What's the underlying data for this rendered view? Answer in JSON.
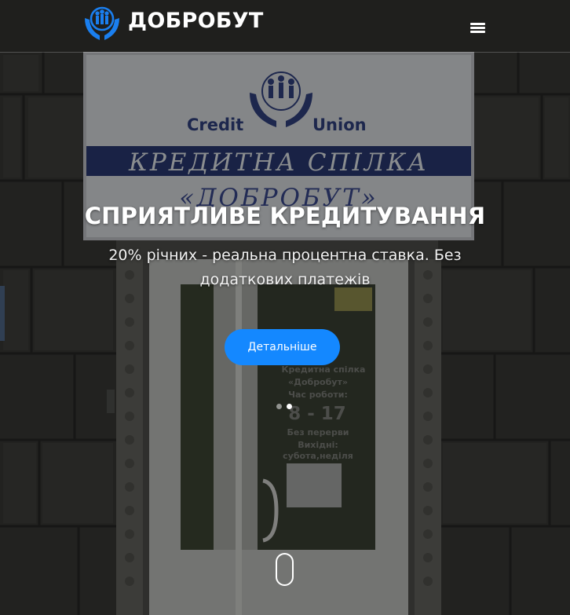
{
  "header": {
    "brand_name": "ДОБРОБУТ",
    "logo_icon": "hands-family-icon",
    "menu_icon": "hamburger-menu-icon"
  },
  "background": {
    "description_icon": "office-entrance-photo",
    "sign_top": "Credit Union",
    "sign_middle": "КРЕДИТНА СПІЛКА",
    "sign_bottom": "«ДОБРОБУТ»",
    "door_notice": {
      "line1": "Кредитна спілка",
      "line2": "«Добробут»",
      "line3": "Час роботи:",
      "line4": "8 - 17",
      "line5": "Без перерви",
      "line6": "Вихідні:",
      "line7": "субота,неділя"
    }
  },
  "slide": {
    "title": "СПРИЯТЛИВЕ КРЕДИТУВАННЯ",
    "subtitle": "20% річних - реальна процентна ставка. Без додаткових платежів",
    "button_label": "Детальніше"
  },
  "carousel": {
    "slides_count": 2,
    "active_index": 1
  },
  "scroll_indicator": "scroll-mouse-icon",
  "colors": {
    "accent": "#1488ff",
    "text": "#ffffff"
  }
}
